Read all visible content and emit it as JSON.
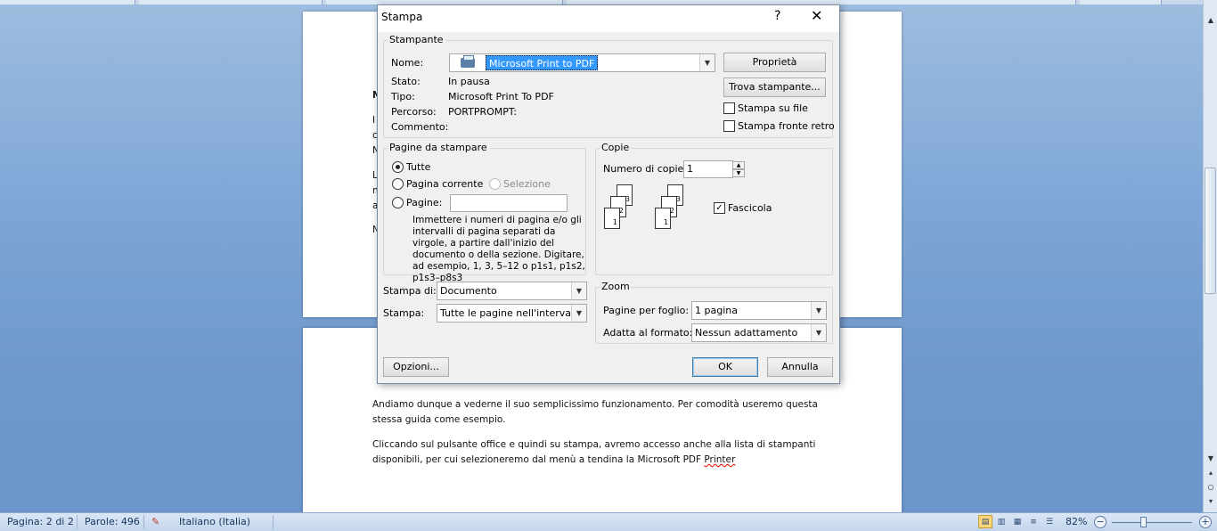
{
  "document": {
    "fragments_page1": [
      "N",
      "I",
      "c",
      "N",
      "L",
      "n",
      "a",
      "N"
    ],
    "paragraph1": "Andiamo dunque a vederne il suo semplicissimo funzionamento. Per comodità useremo questa stessa guida come esempio.",
    "paragraph2_a": "Cliccando sul pulsante office e quindi su stampa, avremo accesso anche alla lista di stampanti disponibili, per cui selezioneremo dal menù a tendina la Microsoft PDF ",
    "paragraph2_b": "Printer"
  },
  "dialog": {
    "title": "Stampa",
    "help": "?",
    "close": "✕",
    "printer": {
      "legend": "Stampante",
      "name_label": "Nome:",
      "name_value": "Microsoft Print to PDF",
      "properties_button": "Proprietà",
      "find_button": "Trova stampante...",
      "status_label": "Stato:",
      "status_value": "In pausa",
      "type_label": "Tipo:",
      "type_value": "Microsoft Print To PDF",
      "path_label": "Percorso:",
      "path_value": "PORTPROMPT:",
      "comment_label": "Commento:",
      "print_to_file": "Stampa su file",
      "duplex": "Stampa fronte retro"
    },
    "pages": {
      "legend": "Pagine da stampare",
      "all": "Tutte",
      "current": "Pagina corrente",
      "selection": "Selezione",
      "pages": "Pagine:",
      "pages_value": "",
      "hint": "Immettere i numeri di pagina e/o gli intervalli di pagina separati da virgole, a partire dall'inizio del documento o della sezione. Digitare, ad esempio, 1, 3, 5–12 o p1s1, p1s2, p1s3–p8s3"
    },
    "copies": {
      "legend": "Copie",
      "count_label": "Numero di copie:",
      "count_value": "1",
      "collate": "Fascicola",
      "sheet_labels": [
        "3",
        "2",
        "1"
      ]
    },
    "print_what_label": "Stampa di:",
    "print_what_value": "Documento",
    "print_label": "Stampa:",
    "print_value": "Tutte le pagine nell'intervallo",
    "zoom": {
      "legend": "Zoom",
      "pages_per_sheet_label": "Pagine per foglio:",
      "pages_per_sheet_value": "1 pagina",
      "scale_label": "Adatta al formato:",
      "scale_value": "Nessun adattamento"
    },
    "options_button": "Opzioni...",
    "ok_button": "OK",
    "cancel_button": "Annulla"
  },
  "statusbar": {
    "page": "Pagina: 2 di 2",
    "words": "Parole: 496",
    "language": "Italiano (Italia)",
    "zoom": "82%",
    "zoom_minus": "−",
    "zoom_plus": "+"
  },
  "colors": {
    "selection": "#3399ff",
    "accent": "#3c7fb1"
  }
}
